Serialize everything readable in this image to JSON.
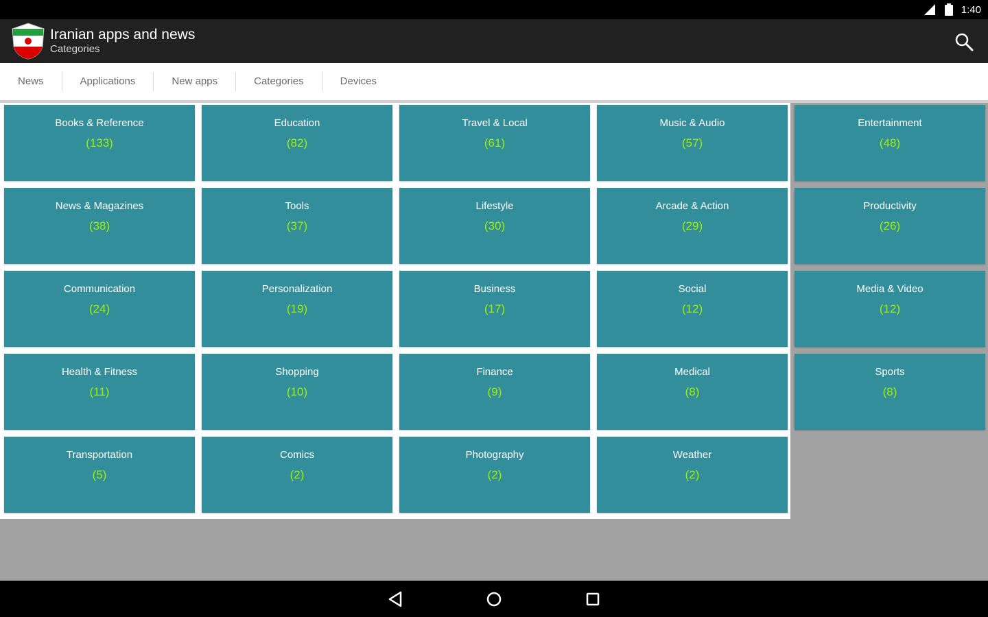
{
  "status_bar": {
    "time": "1:40",
    "icons": [
      "signal-icon",
      "battery-icon"
    ]
  },
  "app_bar": {
    "title": "Iranian apps and news",
    "subtitle": "Categories",
    "logo_icon": "iran-flag-logo",
    "search_icon": "search-icon"
  },
  "tabs": [
    "News",
    "Applications",
    "New apps",
    "Categories",
    "Devices"
  ],
  "categories": [
    {
      "name": "Books & Reference",
      "count": "(133)"
    },
    {
      "name": "Education",
      "count": "(82)"
    },
    {
      "name": "Travel & Local",
      "count": "(61)"
    },
    {
      "name": "Music & Audio",
      "count": "(57)"
    },
    {
      "name": "Entertainment",
      "count": "(48)"
    },
    {
      "name": "News & Magazines",
      "count": "(38)"
    },
    {
      "name": "Tools",
      "count": "(37)"
    },
    {
      "name": "Lifestyle",
      "count": "(30)"
    },
    {
      "name": "Arcade & Action",
      "count": "(29)"
    },
    {
      "name": "Productivity",
      "count": "(26)"
    },
    {
      "name": "Communication",
      "count": "(24)"
    },
    {
      "name": "Personalization",
      "count": "(19)"
    },
    {
      "name": "Business",
      "count": "(17)"
    },
    {
      "name": "Social",
      "count": "(12)"
    },
    {
      "name": "Media & Video",
      "count": "(12)"
    },
    {
      "name": "Health & Fitness",
      "count": "(11)"
    },
    {
      "name": "Shopping",
      "count": "(10)"
    },
    {
      "name": "Finance",
      "count": "(9)"
    },
    {
      "name": "Medical",
      "count": "(8)"
    },
    {
      "name": "Sports",
      "count": "(8)"
    },
    {
      "name": "Transportation",
      "count": "(5)"
    },
    {
      "name": "Comics",
      "count": "(2)"
    },
    {
      "name": "Photography",
      "count": "(2)"
    },
    {
      "name": "Weather",
      "count": "(2)"
    }
  ],
  "nav_bar": {
    "icons": [
      "back-icon",
      "home-icon",
      "recents-icon"
    ]
  },
  "colors": {
    "tile": "#338e9c",
    "count_text": "#9ff000",
    "action_bar": "#212121",
    "background": "#a2a2a2"
  }
}
